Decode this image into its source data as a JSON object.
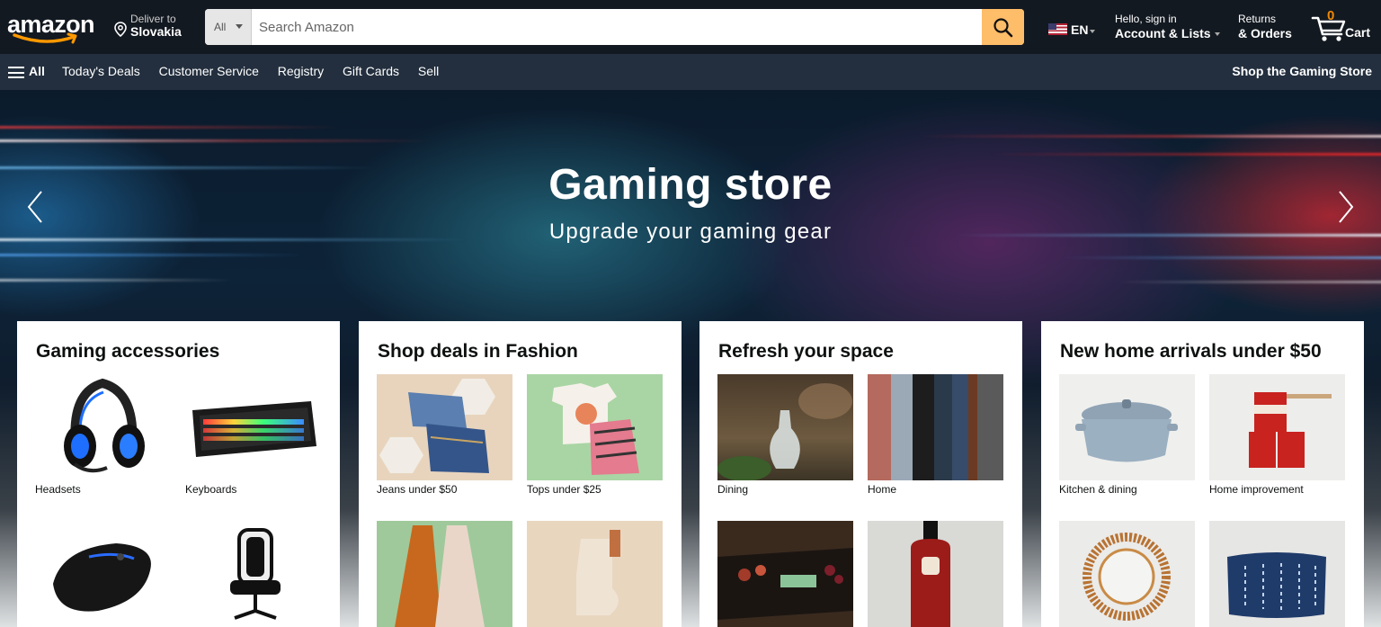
{
  "header": {
    "logo_text": "amazon",
    "deliver_line1": "Deliver to",
    "deliver_line2": "Slovakia",
    "search": {
      "category": "All",
      "placeholder": "Search Amazon"
    },
    "language": "EN",
    "account_line1": "Hello, sign in",
    "account_line2": "Account & Lists",
    "orders_line1": "Returns",
    "orders_line2": "& Orders",
    "cart_count": "0",
    "cart_label": "Cart"
  },
  "nav": {
    "all_label": "All",
    "links": [
      "Today's Deals",
      "Customer Service",
      "Registry",
      "Gift Cards",
      "Sell"
    ],
    "right_link": "Shop the Gaming Store"
  },
  "hero": {
    "title": "Gaming store",
    "subtitle": "Upgrade your gaming gear"
  },
  "cards": [
    {
      "title": "Gaming accessories",
      "tiles": [
        {
          "caption": "Headsets",
          "icon": "headset-image"
        },
        {
          "caption": "Keyboards",
          "icon": "keyboard-image"
        },
        {
          "caption": "",
          "icon": "mouse-image"
        },
        {
          "caption": "",
          "icon": "gaming-chair-image"
        }
      ]
    },
    {
      "title": "Shop deals in Fashion",
      "tiles": [
        {
          "caption": "Jeans under $50",
          "icon": "jeans-image"
        },
        {
          "caption": "Tops under $25",
          "icon": "tops-image"
        },
        {
          "caption": "",
          "icon": "dresses-image"
        },
        {
          "caption": "",
          "icon": "boots-image"
        }
      ]
    },
    {
      "title": "Refresh your space",
      "tiles": [
        {
          "caption": "Dining",
          "icon": "dining-image"
        },
        {
          "caption": "Home",
          "icon": "home-image"
        },
        {
          "caption": "",
          "icon": "kitchen-image"
        },
        {
          "caption": "",
          "icon": "bath-bottle-image"
        }
      ]
    },
    {
      "title": "New home arrivals under $50",
      "tiles": [
        {
          "caption": "Kitchen & dining",
          "icon": "dutch-oven-image"
        },
        {
          "caption": "Home improvement",
          "icon": "paint-cans-image"
        },
        {
          "caption": "",
          "icon": "mirror-image"
        },
        {
          "caption": "",
          "icon": "pillow-image"
        }
      ]
    }
  ],
  "colors": {
    "header_bg": "#131921",
    "nav_bg": "#232f3e",
    "search_button": "#febd69",
    "cart_count": "#f08804",
    "logo_smile": "#ff9900"
  }
}
